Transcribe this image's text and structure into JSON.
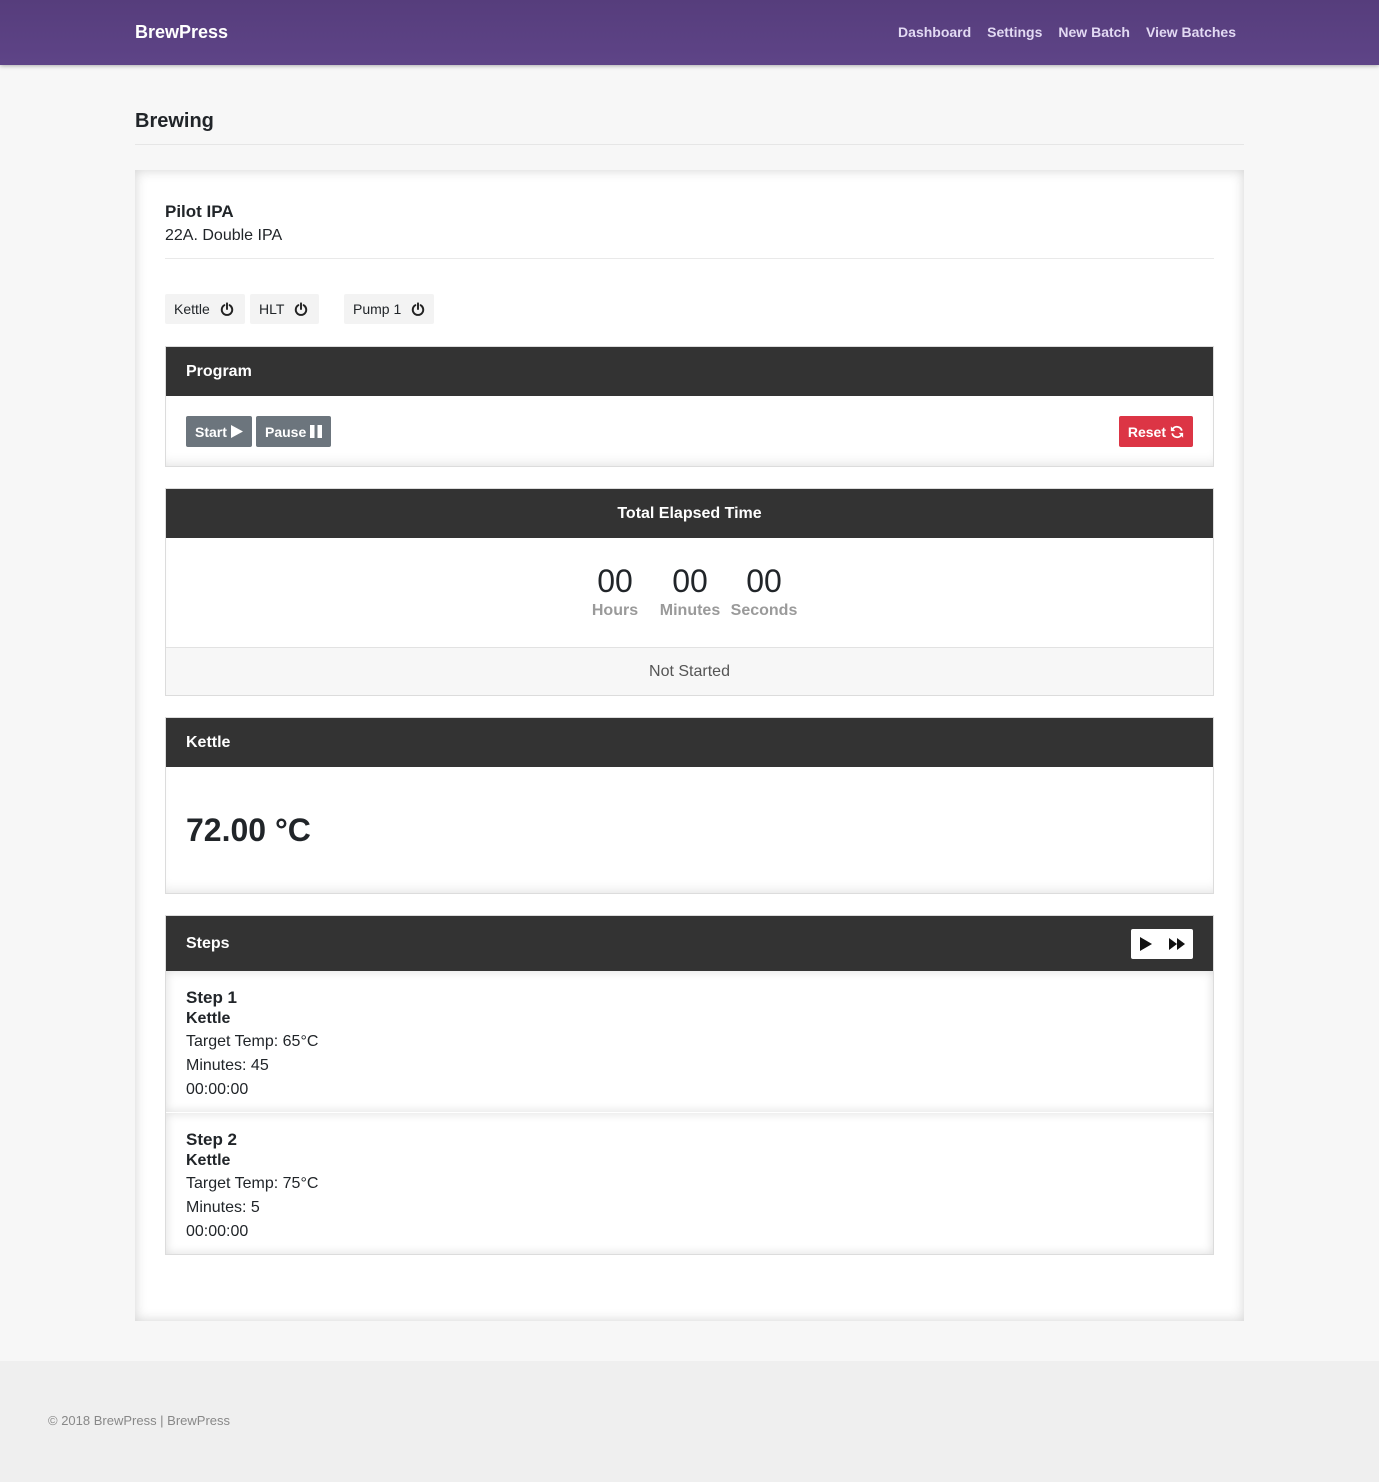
{
  "nav": {
    "brand": "BrewPress",
    "links": [
      "Dashboard",
      "Settings",
      "New Batch",
      "View Batches"
    ]
  },
  "page": {
    "title": "Brewing"
  },
  "batch": {
    "name": "Pilot IPA",
    "style": "22A. Double IPA"
  },
  "toggles": [
    {
      "label": "Kettle",
      "icon": "power-icon"
    },
    {
      "label": "HLT",
      "icon": "power-icon"
    },
    {
      "label": "Pump 1",
      "icon": "power-icon"
    }
  ],
  "program": {
    "title": "Program",
    "start_label": "Start",
    "pause_label": "Pause",
    "reset_label": "Reset"
  },
  "elapsed": {
    "title": "Total Elapsed Time",
    "hours": "00",
    "minutes": "00",
    "seconds": "00",
    "hours_label": "Hours",
    "minutes_label": "Minutes",
    "seconds_label": "Seconds",
    "status": "Not Started"
  },
  "kettle": {
    "title": "Kettle",
    "temperature": "72.00 °C"
  },
  "steps": {
    "title": "Steps",
    "items": [
      {
        "title": "Step 1",
        "vessel": "Kettle",
        "target": "Target Temp: 65°C",
        "minutes": "Minutes: 45",
        "time": "00:00:00"
      },
      {
        "title": "Step 2",
        "vessel": "Kettle",
        "target": "Target Temp: 75°C",
        "minutes": "Minutes: 5",
        "time": "00:00:00"
      }
    ]
  },
  "footer": {
    "text": "© 2018 BrewPress | BrewPress"
  },
  "colors": {
    "nav": "#563d7c",
    "panel_header": "#333333",
    "danger": "#dc3545",
    "secondary": "#6c757d"
  }
}
